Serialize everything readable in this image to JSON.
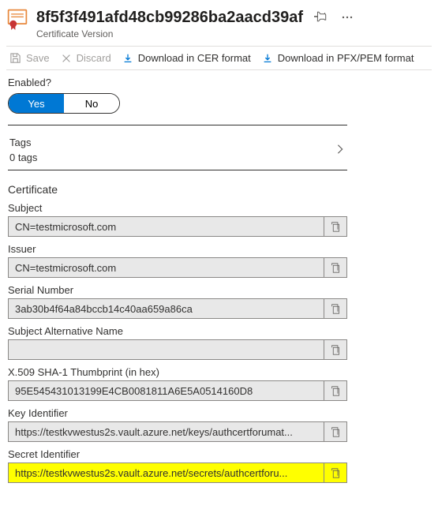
{
  "header": {
    "title": "8f5f3f491afd48cb99286ba2aacd39af",
    "subtitle": "Certificate Version"
  },
  "toolbar": {
    "save": "Save",
    "discard": "Discard",
    "download_cer": "Download in CER format",
    "download_pfx": "Download in PFX/PEM format"
  },
  "enabled": {
    "label": "Enabled?",
    "yes": "Yes",
    "no": "No"
  },
  "tags": {
    "label": "Tags",
    "count_text": "0 tags"
  },
  "certificate": {
    "heading": "Certificate",
    "subject_label": "Subject",
    "subject_value": "CN=testmicrosoft.com",
    "issuer_label": "Issuer",
    "issuer_value": "CN=testmicrosoft.com",
    "serial_label": "Serial Number",
    "serial_value": "3ab30b4f64a84bccb14c40aa659a86ca",
    "san_label": "Subject Alternative Name",
    "san_value": "",
    "thumbprint_label": "X.509 SHA-1 Thumbprint (in hex)",
    "thumbprint_value": "95E545431013199E4CB0081811A6E5A0514160D8",
    "key_id_label": "Key Identifier",
    "key_id_value": "https://testkvwestus2s.vault.azure.net/keys/authcertforumat...",
    "secret_id_label": "Secret Identifier",
    "secret_id_value": "https://testkvwestus2s.vault.azure.net/secrets/authcertforu..."
  }
}
